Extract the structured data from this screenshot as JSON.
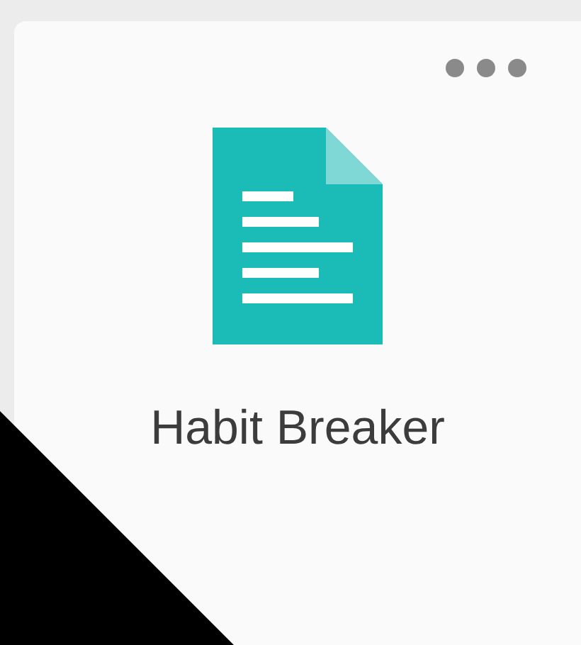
{
  "card": {
    "title": "Habit Breaker"
  }
}
